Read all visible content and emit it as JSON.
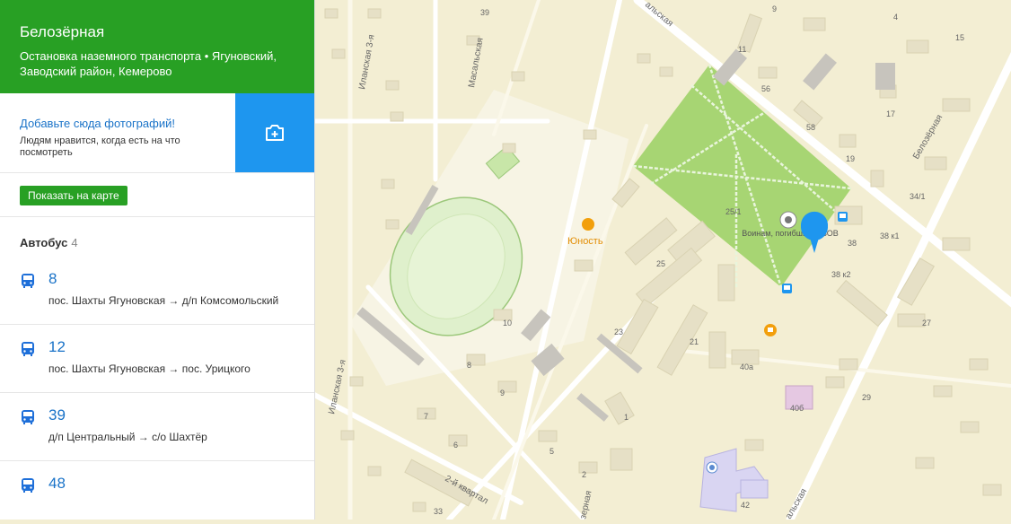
{
  "stop": {
    "title": "Белозёрная",
    "subtitle": "Остановка наземного транспорта • Ягуновский, Заводский район, Кемерово"
  },
  "photo": {
    "link": "Добавьте сюда фотографий!",
    "desc": "Людям нравится, когда есть на что посмотреть"
  },
  "show_map_label": "Показать на карте",
  "transport": {
    "label": "Автобус",
    "count": "4",
    "routes": [
      {
        "number": "8",
        "direction": "пос. Шахты Ягуновская → д/п Комсомольский"
      },
      {
        "number": "12",
        "direction": "пос. Шахты Ягуновская → пос. Урицкого"
      },
      {
        "number": "39",
        "direction": "д/п Центральный → с/о Шахтёр"
      },
      {
        "number": "48",
        "direction": ""
      }
    ]
  },
  "map": {
    "streets": {
      "ilanskaya_3": "Иланская 3-я",
      "masalskaya": "Масальская",
      "belozernaya": "Белозёрная",
      "kvartal_2": "2-й квартал",
      "malskaya": "альская",
      "ezernaya": "зерная",
      "alskaya_bottom": "альская"
    },
    "poi": {
      "yunost": "Юность",
      "monument": "Воинам, погибшим в ВОВ"
    },
    "buildings": [
      "39",
      "4",
      "9",
      "15",
      "11",
      "56",
      "17",
      "58",
      "19",
      "34/1",
      "25/1",
      "38",
      "38 к1",
      "38 к2",
      "25",
      "27",
      "10",
      "23",
      "21",
      "40а",
      "8",
      "29",
      "40б",
      "9",
      "7",
      "1",
      "6",
      "5",
      "2",
      "42",
      "33"
    ],
    "colors": {
      "park": "#a7d573",
      "road": "#ffffff",
      "land": "#f3eed3",
      "pin": "#1e96ef",
      "poi": "#f29f0c"
    }
  }
}
